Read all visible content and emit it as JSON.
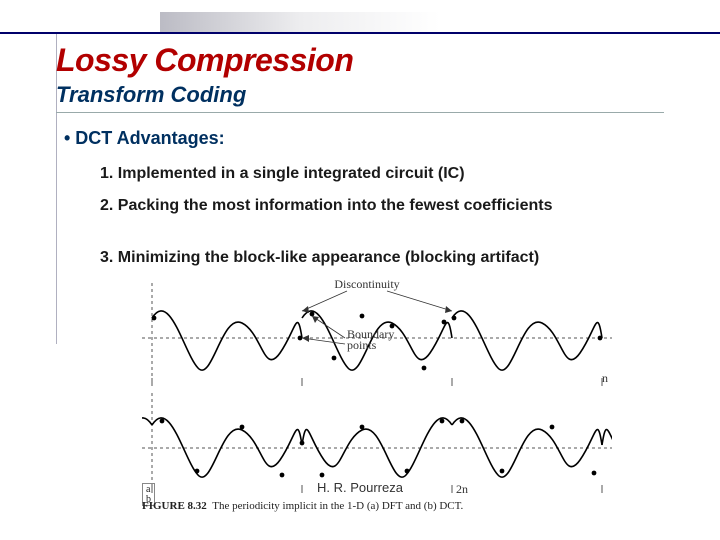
{
  "title": "Lossy Compression",
  "subtitle": "Transform Coding",
  "section_heading": "• DCT Advantages:",
  "items": {
    "i1": "1. Implemented in a single integrated circuit (IC)",
    "i2": "2. Packing the most information into the fewest coefficients",
    "i3": "3. Minimizing the block-like appearance (blocking artifact)"
  },
  "figure": {
    "annot_discontinuity": "Discontinuity",
    "annot_boundary": "Boundary\npoints",
    "axis_n_top": "n",
    "axis_2n": "2n",
    "ab_a": "a",
    "ab_b": "b",
    "caption_label": "FIGURE 8.32",
    "caption_text": "The periodicity implicit in the 1-D (a) DFT and (b) DCT."
  },
  "credit": "H. R. Pourreza"
}
